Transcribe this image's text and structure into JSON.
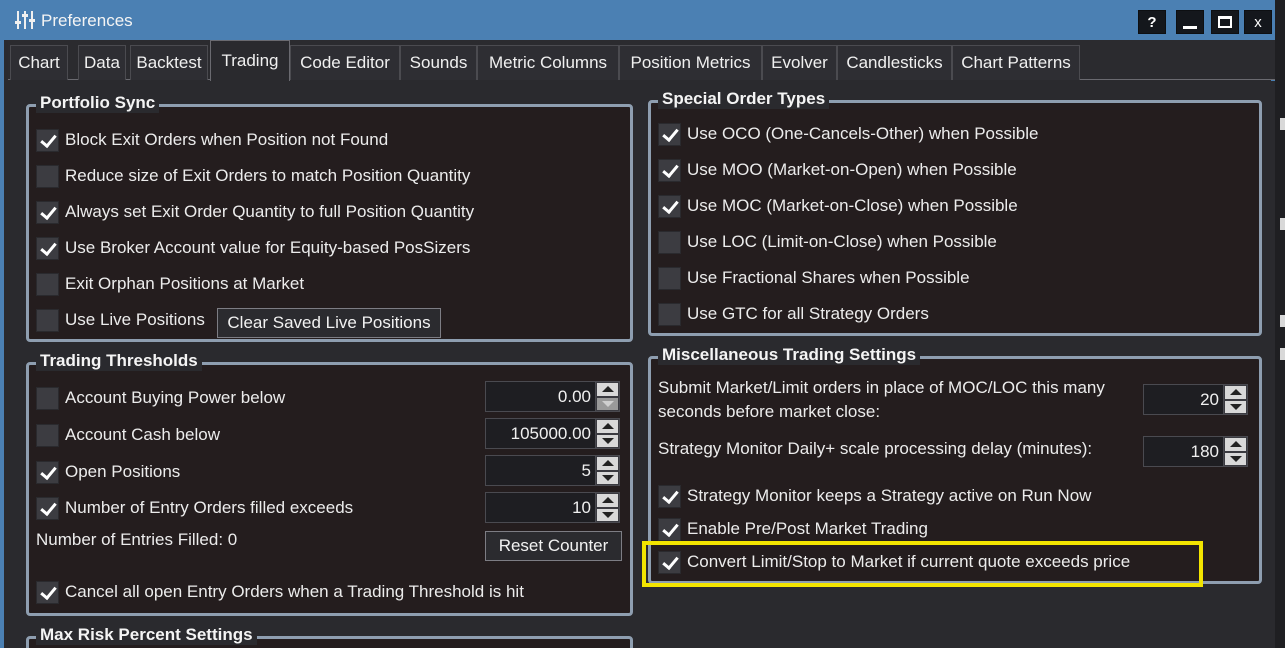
{
  "window": {
    "title": "Preferences"
  },
  "title_buttons": {
    "help": "?",
    "close": "x"
  },
  "tabs": [
    "Chart",
    "Data",
    "Backtest",
    "Trading",
    "Code Editor",
    "Sounds",
    "Metric Columns",
    "Position Metrics",
    "Evolver",
    "Candlesticks",
    "Chart Patterns"
  ],
  "active_tab": "Trading",
  "portfolio_sync": {
    "title": "Portfolio Sync",
    "items": [
      {
        "label": "Block Exit Orders when Position not Found",
        "checked": true
      },
      {
        "label": "Reduce size of Exit Orders to match Position Quantity",
        "checked": false
      },
      {
        "label": "Always set Exit Order Quantity to full Position Quantity",
        "checked": true
      },
      {
        "label": "Use Broker Account value for Equity-based PosSizers",
        "checked": true
      },
      {
        "label": "Exit Orphan Positions at Market",
        "checked": false
      },
      {
        "label": "Use Live Positions",
        "checked": false
      }
    ],
    "clear_button": "Clear Saved Live Positions"
  },
  "trading_thresholds": {
    "title": "Trading Thresholds",
    "items": [
      {
        "label": "Account Buying Power below",
        "checked": false,
        "value": "0.00"
      },
      {
        "label": "Account Cash below",
        "checked": false,
        "value": "105000.00"
      },
      {
        "label": "Open Positions",
        "checked": true,
        "value": "5"
      },
      {
        "label": "Number of Entry Orders filled exceeds",
        "checked": true,
        "value": "10"
      }
    ],
    "entries_filled": "Number of Entries Filled: 0",
    "reset_button": "Reset Counter",
    "cancel_all": {
      "label": "Cancel all open Entry Orders when a Trading Threshold is hit",
      "checked": true
    }
  },
  "max_risk": {
    "title": "Max Risk Percent Settings"
  },
  "special_orders": {
    "title": "Special Order Types",
    "items": [
      {
        "label": "Use OCO (One-Cancels-Other) when Possible",
        "checked": true
      },
      {
        "label": "Use MOO (Market-on-Open) when Possible",
        "checked": true
      },
      {
        "label": "Use MOC (Market-on-Close) when Possible",
        "checked": true
      },
      {
        "label": "Use LOC (Limit-on-Close) when Possible",
        "checked": false
      },
      {
        "label": "Use Fractional Shares when Possible",
        "checked": false
      },
      {
        "label": "Use GTC for all Strategy Orders",
        "checked": false
      }
    ]
  },
  "misc": {
    "title": "Miscellaneous Trading Settings",
    "submit_label_1": "Submit Market/Limit orders in place of MOC/LOC this many",
    "submit_label_2": "seconds before market close:",
    "submit_value": "20",
    "delay_label": "Strategy Monitor Daily+ scale processing delay (minutes):",
    "delay_value": "180",
    "items": [
      {
        "label": "Strategy Monitor keeps a Strategy active on Run Now",
        "checked": true
      },
      {
        "label": "Enable Pre/Post Market Trading",
        "checked": true
      },
      {
        "label": "Convert Limit/Stop to Market if current quote exceeds price",
        "checked": true
      }
    ]
  },
  "colors": {
    "titlebar": "#4b80b3",
    "group_border": "#8e9eb0",
    "highlight": "#f2e400"
  }
}
